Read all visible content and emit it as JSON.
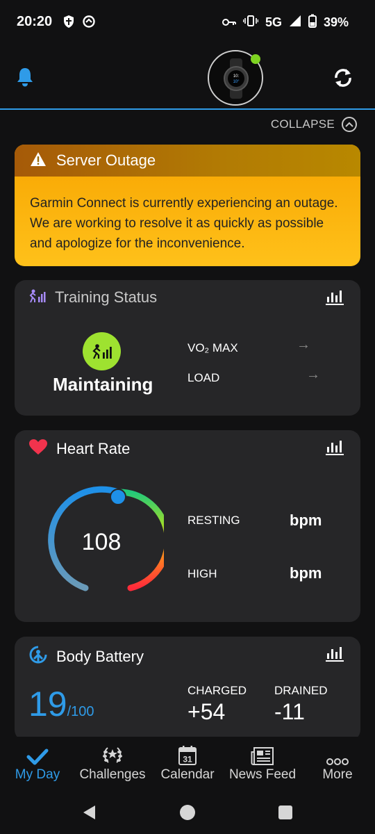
{
  "status_bar": {
    "time": "20:20",
    "network": "5G",
    "battery": "39%",
    "icons_left": [
      "shield-icon",
      "vpn-icon"
    ],
    "icons_right": [
      "key-icon",
      "vibrate-icon",
      "signal-icon",
      "battery-icon"
    ]
  },
  "top_bar": {
    "icons": [
      "bell-icon",
      "watch-avatar",
      "sync-icon"
    ],
    "device_connected_color": "#7ed321"
  },
  "collapse": {
    "label": "COLLAPSE"
  },
  "alert": {
    "title": "Server Outage",
    "message": "Garmin Connect is currently experiencing an outage. We are working to resolve it as quickly as possible and apologize for the inconvenience.",
    "color": "#ffc11a"
  },
  "training_status": {
    "title": "Training Status",
    "status": "Maintaining",
    "badge_color": "#9ee230",
    "vo2_label": "VO₂ MAX",
    "load_label": "LOAD",
    "arrow": "→"
  },
  "heart_rate": {
    "title": "Heart Rate",
    "current": "108",
    "resting_label": "RESTING",
    "resting_unit": "bpm",
    "high_label": "HIGH",
    "high_unit": "bpm"
  },
  "body_battery": {
    "title": "Body Battery",
    "value": "19",
    "max": "/100",
    "charged_label": "CHARGED",
    "charged_value": "+54",
    "drained_label": "DRAINED",
    "drained_value": "-11",
    "accent": "#2f9be8"
  },
  "bottom_nav": {
    "items": [
      {
        "label": "My Day",
        "icon": "check-icon",
        "active": true
      },
      {
        "label": "Challenges",
        "icon": "laurel-icon",
        "active": false
      },
      {
        "label": "Calendar",
        "icon": "calendar-icon",
        "day": "31",
        "active": false
      },
      {
        "label": "News Feed",
        "icon": "newspaper-icon",
        "active": false
      },
      {
        "label": "More",
        "icon": "more-dots-icon",
        "active": false
      }
    ]
  },
  "system_nav": [
    "back-icon",
    "home-icon",
    "recents-icon"
  ]
}
